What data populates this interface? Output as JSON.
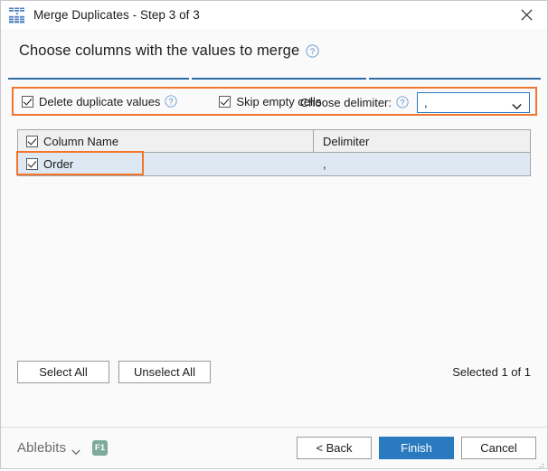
{
  "window": {
    "title": "Merge Duplicates - Step 3 of 3",
    "icon": "merge-duplicates-icon",
    "close_icon": "close-icon"
  },
  "header": {
    "title": "Choose columns with the values to merge",
    "help_icon": "help-circle-icon"
  },
  "steps": {
    "total": 3,
    "current": 3,
    "accent_color": "#2d6ca8"
  },
  "options": {
    "highlight_color": "#f2762e",
    "delete_duplicates": {
      "label": "Delete duplicate values",
      "checked": true,
      "help_icon": "help-circle-icon"
    },
    "skip_empty": {
      "label": "Skip empty cells",
      "checked": true
    },
    "delimiter": {
      "label": "Choose delimiter:",
      "help_icon": "help-circle-icon",
      "value": ",",
      "arrow_icon": "chevron-down-icon"
    }
  },
  "grid": {
    "select_all_checked": true,
    "headers": [
      "Column Name",
      "Delimiter"
    ],
    "rows": [
      {
        "checked": true,
        "name": "Order",
        "delimiter": ","
      }
    ],
    "row_highlight_color": "#f2762e",
    "row_selected_color": "#dde8f2"
  },
  "actions": {
    "select_all": "Select All",
    "unselect_all": "Unselect All",
    "selected_count": "Selected 1 of 1"
  },
  "footer": {
    "brand": "Ablebits",
    "brand_caret_icon": "chevron-down-icon",
    "shortcut_badge": "F1",
    "badge_color": "#7cab9a",
    "back": "< Back",
    "finish": "Finish",
    "cancel": "Cancel",
    "primary_color": "#2a7ac0"
  }
}
